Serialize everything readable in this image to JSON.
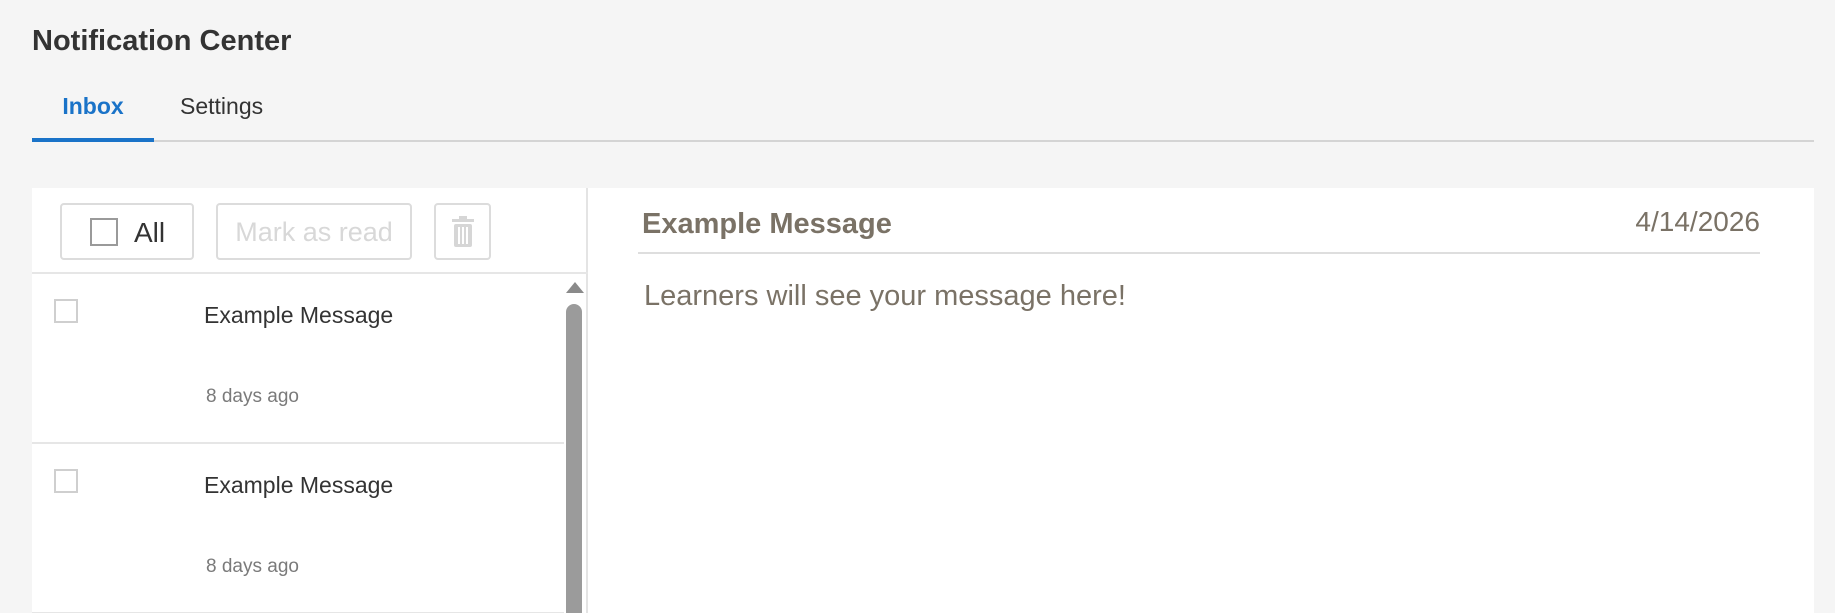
{
  "header": {
    "title": "Notification Center"
  },
  "tabs": [
    {
      "label": "Inbox",
      "active": true
    },
    {
      "label": "Settings",
      "active": false
    }
  ],
  "toolbar": {
    "select_all_label": "All",
    "mark_read_label": "Mark as read",
    "delete_icon": "trash-icon"
  },
  "messages": [
    {
      "subject": "Example Message",
      "time": "8 days ago"
    },
    {
      "subject": "Example Message",
      "time": "8 days ago"
    }
  ],
  "detail": {
    "subject": "Example Message",
    "date": "4/14/2026",
    "body": "Learners will see your message here!"
  },
  "colors": {
    "accent": "#1a73c8",
    "background": "#f5f5f5",
    "detail_text": "#7a7266"
  }
}
